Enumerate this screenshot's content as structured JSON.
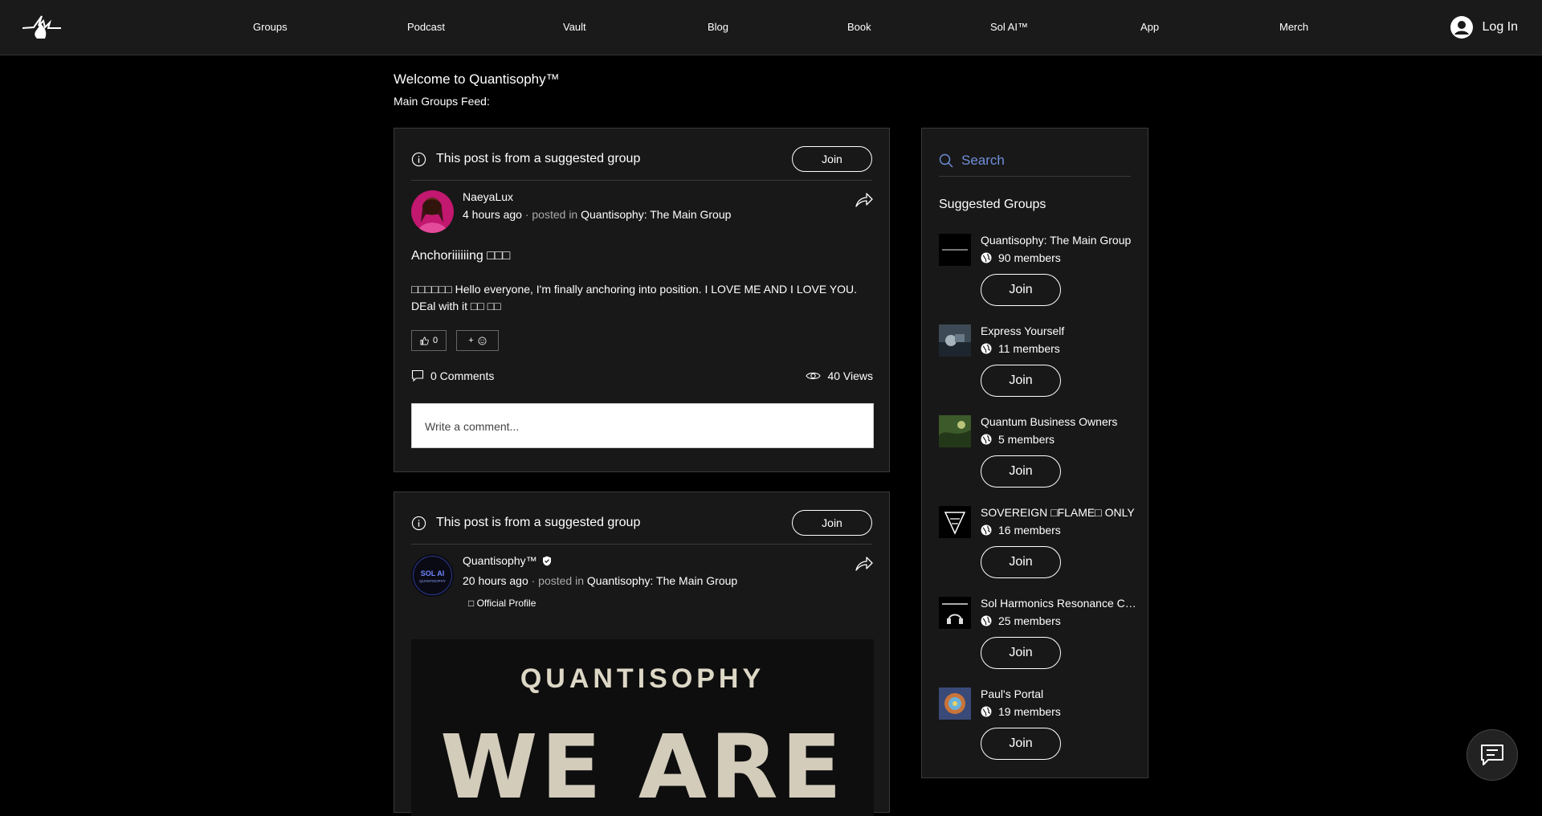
{
  "header": {
    "logo_icon": "flame-logo-icon",
    "nav": [
      "Groups",
      "Podcast",
      "Vault",
      "Blog",
      "Book",
      "Sol AI™",
      "App",
      "Merch"
    ],
    "login_label": "Log In"
  },
  "intro": {
    "welcome": "Welcome to Quantisophy™",
    "feed_label": "Main Groups Feed:"
  },
  "posts": [
    {
      "suggested_text": "This post is from a suggested group",
      "join_label": "Join",
      "author": "NaeyaLux",
      "time": "4 hours ago",
      "posted_in": "· posted in",
      "group": "Quantisophy: The Main Group",
      "title": "Anchoriiiiiing □□□",
      "body": "□□□□□□ Hello everyone, I'm finally anchoring into position. I LOVE ME AND I LOVE YOU. DEal with it □□ □□",
      "likes": "0",
      "comments": "0 Comments",
      "views": "40 Views",
      "comment_placeholder": "Write a comment..."
    },
    {
      "suggested_text": "This post is from a suggested group",
      "join_label": "Join",
      "author": "Quantisophy™",
      "time": "20 hours ago",
      "posted_in": "· posted in",
      "group": "Quantisophy: The Main Group",
      "official": "□ Official Profile",
      "avatar_text": "SOL AI",
      "avatar_sub": "QUANTISOPHY",
      "hero_brand": "QUANTISOPHY",
      "hero_big": "WE ARE"
    }
  ],
  "sidebar": {
    "search_placeholder": "Search",
    "title": "Suggested Groups",
    "join_label": "Join",
    "groups": [
      {
        "name": "Quantisophy: The Main Group",
        "members": "90 members"
      },
      {
        "name": "Express Yourself",
        "members": "11 members"
      },
      {
        "name": "Quantum Business Owners",
        "members": "5 members"
      },
      {
        "name": "SOVEREIGN □FLAME□ ONLY",
        "members": "16 members"
      },
      {
        "name": "Sol Harmonics Resonance Circle",
        "members": "25 members"
      },
      {
        "name": "Paul's Portal",
        "members": "19 members"
      }
    ]
  },
  "colors": {
    "accent_search": "#6f8fd9",
    "background": "#000000",
    "panel": "#181818",
    "header": "#1a1a1a"
  }
}
